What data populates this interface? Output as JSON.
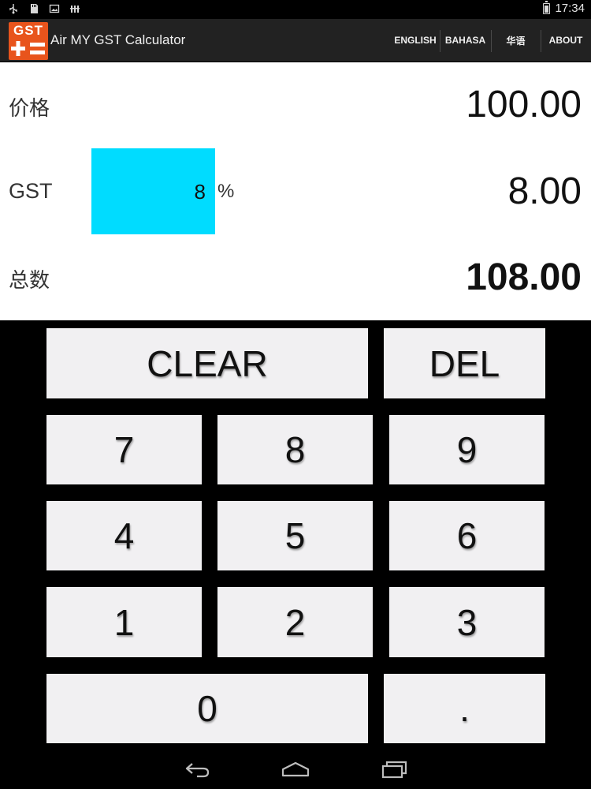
{
  "status_bar": {
    "time": "17:34",
    "icons": [
      "usb-icon",
      "sd-card-icon",
      "image-icon",
      "signal-bars-icon",
      "battery-icon"
    ]
  },
  "app": {
    "title": "Air MY GST Calculator",
    "logo_text": "GST",
    "brand_color": "#e8541c"
  },
  "menu": {
    "items": [
      {
        "label": "ENGLISH"
      },
      {
        "label": "BAHASA"
      },
      {
        "label": "华语"
      },
      {
        "label": "ABOUT"
      }
    ]
  },
  "display": {
    "price_label": "价格",
    "price_value": "100.00",
    "gst_label": "GST",
    "gst_rate": "8",
    "gst_rate_unit": "%",
    "gst_rate_color": "#00dcff",
    "gst_value": "8.00",
    "total_label": "总数",
    "total_value": "108.00"
  },
  "keypad": {
    "clear": "CLEAR",
    "del": "DEL",
    "digits": [
      "7",
      "8",
      "9",
      "4",
      "5",
      "6",
      "1",
      "2",
      "3"
    ],
    "zero": "0",
    "dot": ".",
    "key_color": "#f1f0f2"
  },
  "nav": {
    "icons": [
      "back-icon",
      "home-icon",
      "recent-apps-icon"
    ]
  }
}
